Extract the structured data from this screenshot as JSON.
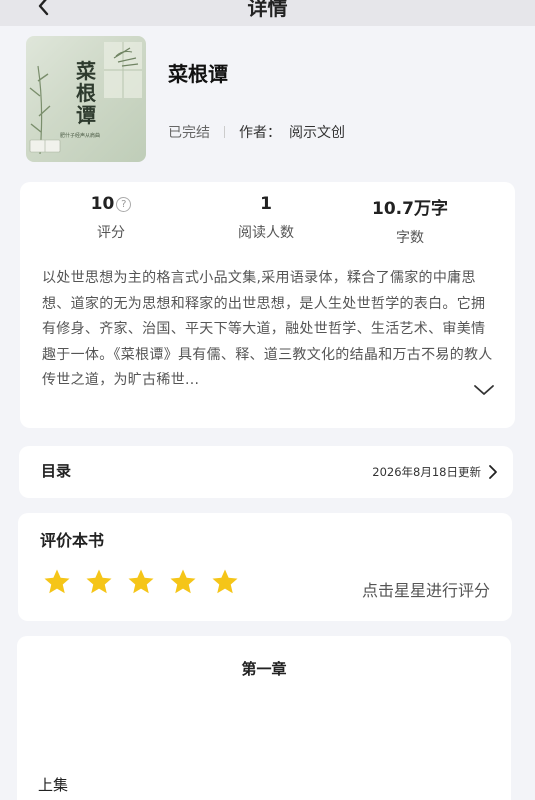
{
  "topbar": {
    "title": "详情",
    "back_icon": "chevron-left-icon"
  },
  "book": {
    "title": "菜根谭",
    "cover_title": "菜根谭",
    "cover_subtitle": "肥什子经声从肩曲",
    "status": "已完结",
    "author_label": "作者：",
    "author": "阅示文创"
  },
  "stats": {
    "rating_value": "10",
    "rating_label": "评分",
    "readers_value": "1",
    "readers_label": "阅读人数",
    "words_value": "10.7万字",
    "words_label": "字数"
  },
  "description": "以处世思想为主的格言式小品文集,采用语录体，糅合了儒家的中庸思想、道家的无为思想和释家的出世思想，是人生处世哲学的表白。它拥有修身、齐家、治国、平天下等大道，融处世哲学、生活艺术、审美情趣于一体。《菜根谭》具有儒、释、道三教文化的结晶和万古不易的教人传世之道，为旷古稀世...",
  "toc": {
    "label": "目录",
    "update_text": "2026年8月18日更新"
  },
  "rating": {
    "title": "评价本书",
    "star_count": 5,
    "hint": "点击星星进行评分",
    "star_color": "#f5c518"
  },
  "chapter": {
    "title": "第一章"
  },
  "prev": {
    "label": "上集"
  }
}
